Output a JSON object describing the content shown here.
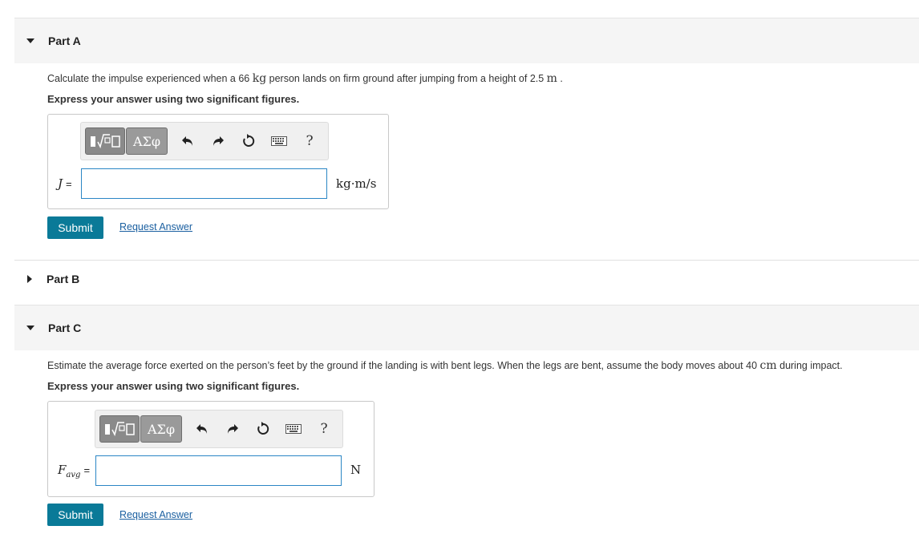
{
  "part_a": {
    "title": "Part A",
    "question_pre": "Calculate the impulse experienced when a 66 ",
    "question_unit1": "kg",
    "question_mid": " person lands on firm ground after jumping from a height of 2.5 ",
    "question_unit2": "m",
    "question_post": " .",
    "instruction": "Express your answer using two significant figures.",
    "toolbar": {
      "templates_label": "▮√□",
      "greek_label": "ΑΣφ",
      "help_label": "?"
    },
    "variable": "J",
    "equals": "=",
    "input_value": "",
    "units": "kg·m/s",
    "submit_label": "Submit",
    "request_label": "Request Answer"
  },
  "part_b": {
    "title": "Part B"
  },
  "part_c": {
    "title": "Part C",
    "question_pre": "Estimate the average force exerted on the person’s feet by the ground if the landing is with bent legs. When the legs are bent, assume the body moves about 40 ",
    "question_unit": "cm",
    "question_post": " during impact.",
    "instruction": "Express your answer using two significant figures.",
    "toolbar": {
      "templates_label": "▮√□",
      "greek_label": "ΑΣφ",
      "help_label": "?"
    },
    "variable": "F",
    "variable_sub": "avg",
    "equals": "=",
    "input_value": "",
    "units": "N",
    "submit_label": "Submit",
    "request_label": "Request Answer"
  },
  "colors": {
    "submit": "#0a7a98",
    "link": "#1a5fa0",
    "input_border": "#2b86c5"
  }
}
